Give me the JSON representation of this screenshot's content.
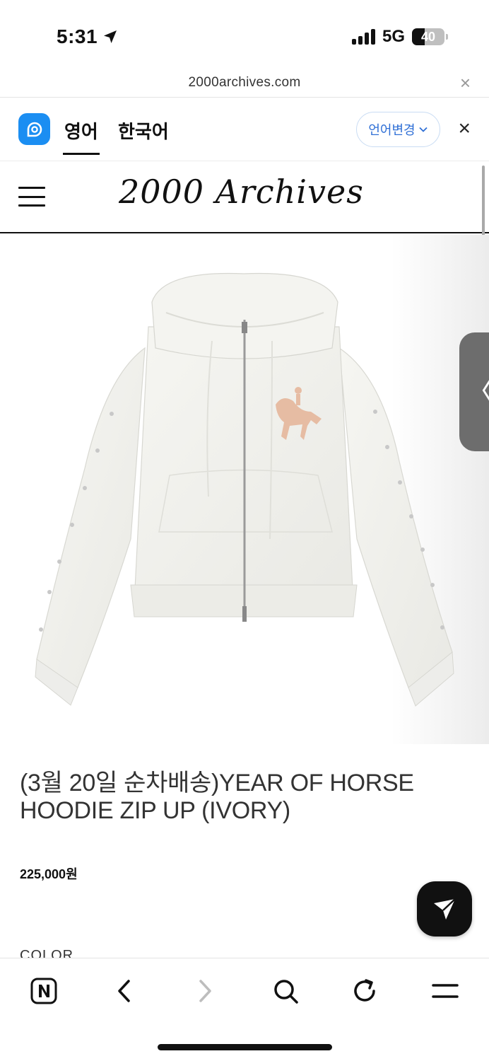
{
  "status": {
    "time": "5:31",
    "network": "5G",
    "battery": "40",
    "battery_level": 0.4
  },
  "browser": {
    "url": "2000archives.com",
    "close_glyph": "×"
  },
  "translate_bar": {
    "tabs": [
      {
        "label": "영어",
        "active": true
      },
      {
        "label": "한국어",
        "active": false
      }
    ],
    "change_label": "언어변경",
    "close_glyph": "×",
    "accent": "#1b8ef2"
  },
  "site": {
    "logo": "2000 Archives",
    "menu_icon": "hamburger-menu-icon"
  },
  "product": {
    "title": "(3월 20일 순차배송)YEAR OF HORSE HOODIE ZIP UP (IVORY)",
    "price": "225,000원",
    "option_label": "COLOR"
  },
  "side_tab": {
    "glyph": "〈"
  },
  "toolbar": {
    "icons": [
      "naver-n-icon",
      "back-icon",
      "forward-icon",
      "search-icon",
      "refresh-icon",
      "menu-icon"
    ]
  }
}
